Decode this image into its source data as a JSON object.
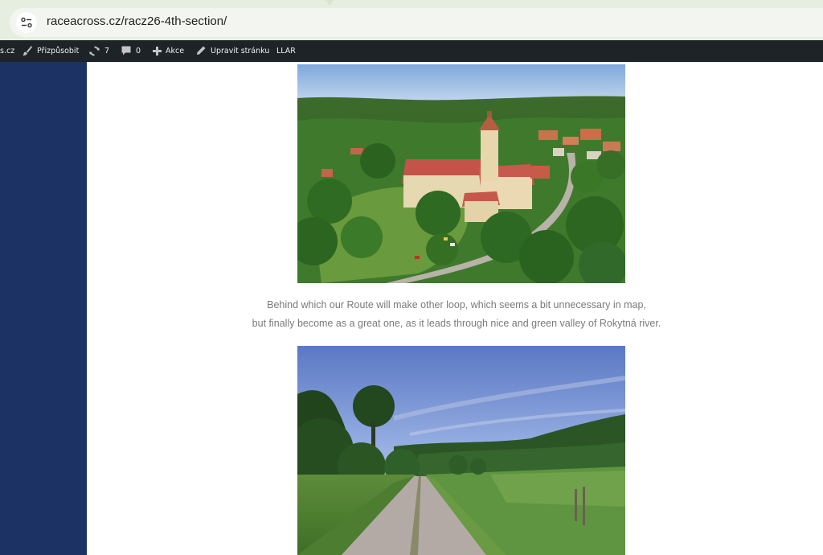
{
  "browser": {
    "url": "raceacross.cz/racz26-4th-section/"
  },
  "admin_bar": {
    "site_fragment": "s.cz",
    "customize_label": "Přizpůsobit",
    "updates_count": "7",
    "comments_count": "0",
    "new_label": "Akce",
    "edit_label": "Upravit stránku",
    "llar_label": "LLAR"
  },
  "article": {
    "images": [
      {
        "name": "aerial view of chateau and village in green hills"
      },
      {
        "name": "dirt road through green valley at dusk"
      }
    ],
    "caption_line_1": "Behind which our Route will make other loop, which seems a bit unnecessary in map,",
    "caption_line_2": "but finally become as a great one, as it leads through nice and green valley of Rokytná river."
  },
  "colors": {
    "sidebar": "#1c3264",
    "admin_bar": "#1d2327",
    "caption_text": "#7a7a7a",
    "browser_chrome": "#e6efdf"
  }
}
